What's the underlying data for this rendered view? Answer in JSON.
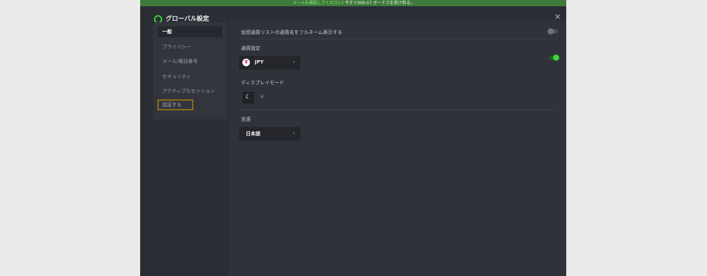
{
  "banner": {
    "link_text": "メールを確認してください!",
    "bonus_text": "今すぐ¥69.67 ボーナスを受け取る。"
  },
  "window": {
    "title": "グローバル設定",
    "close_icon": "close-icon"
  },
  "sidebar": {
    "items": [
      {
        "label": "一般",
        "active": true
      },
      {
        "label": "プライバシー"
      },
      {
        "label": "メール/電話番号"
      },
      {
        "label": "セキュリティ"
      },
      {
        "label": "アクティブなセッション"
      },
      {
        "label": "認証する",
        "highlighted": true
      }
    ]
  },
  "settings": {
    "fullname_toggle": {
      "label": "仮想通貨リストの通貨名をフルネーム表示する",
      "on": false
    },
    "currency": {
      "label": "通貨設定",
      "value": "JPY",
      "icon": "yen-icon",
      "icon_glyph": "¥",
      "toggle_on": true
    },
    "display_mode": {
      "label": "ディスプレイモード",
      "options": [
        {
          "name": "dark",
          "icon": "moon-icon",
          "glyph": "☾",
          "selected": true
        },
        {
          "name": "light",
          "icon": "sun-icon",
          "glyph": "☀",
          "selected": false
        }
      ]
    },
    "language": {
      "label": "言語",
      "value": "日本語"
    },
    "chevron_glyph": "›"
  },
  "colors": {
    "accent": "#39d43d",
    "banner_bg": "#3f7a3c",
    "window_bg": "#2a2d34",
    "highlight_outline": "#8a6d1a"
  }
}
